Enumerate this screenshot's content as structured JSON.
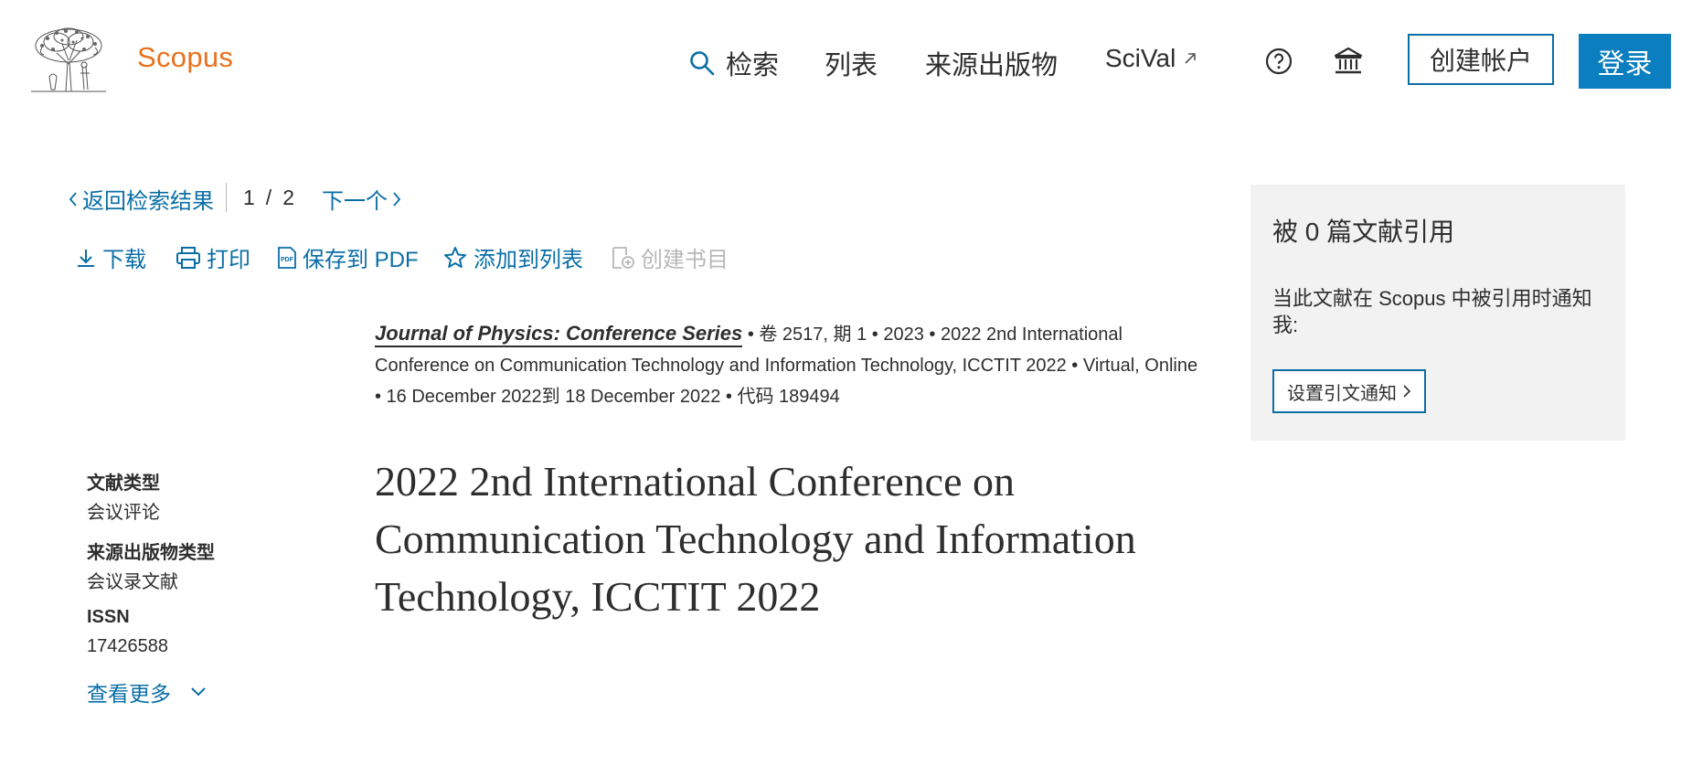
{
  "header": {
    "brand": "Scopus",
    "nav": {
      "search": "检索",
      "lists": "列表",
      "sources": "来源出版物",
      "scival": "SciVal"
    },
    "create_account": "创建帐户",
    "login": "登录"
  },
  "navigation": {
    "back": "返回检索结果",
    "current": "1",
    "separator": "/",
    "total": "2",
    "next": "下一个"
  },
  "toolbar": {
    "download": "下载",
    "print": "打印",
    "save_pdf": "保存到 PDF",
    "add_to_list": "添加到列表",
    "create_bibliography": "创建书目"
  },
  "source": {
    "title": "Journal of Physics: Conference Series",
    "details": " • 卷 2517, 期 1 • 2023 • 2022 2nd International Conference on Communication Technology and Information Technology, ICCTIT 2022 • Virtual, Online • 16 December 2022到 18 December 2022 • 代码 189494"
  },
  "metadata": {
    "doc_type_label": "文献类型",
    "doc_type_value": "会议评论",
    "source_type_label": "来源出版物类型",
    "source_type_value": "会议录文献",
    "issn_label": "ISSN",
    "issn_value": "17426588",
    "show_more": "查看更多"
  },
  "document": {
    "title": "2022 2nd International Conference on Communication Technology and Information Technology, ICCTIT 2022"
  },
  "citations": {
    "count_text": "被 0 篇文献引用",
    "alert_text": "当此文献在 Scopus 中被引用时通知我:",
    "alert_button": "设置引文通知"
  },
  "colors": {
    "link": "#0a6ea6",
    "brand": "#e9711c",
    "login_bg": "#0a7ebf",
    "panel_bg": "#f2f2f2",
    "disabled": "#b8b8b8"
  },
  "icons": {
    "search": "search-icon",
    "external": "external-link-icon",
    "help": "help-circle-icon",
    "institution": "institution-icon",
    "download": "download-icon",
    "print": "print-icon",
    "pdf": "pdf-icon",
    "star": "star-icon",
    "bibliography": "bibliography-icon",
    "chevron_left": "chevron-left-icon",
    "chevron_right": "chevron-right-icon",
    "chevron_down": "chevron-down-icon"
  }
}
